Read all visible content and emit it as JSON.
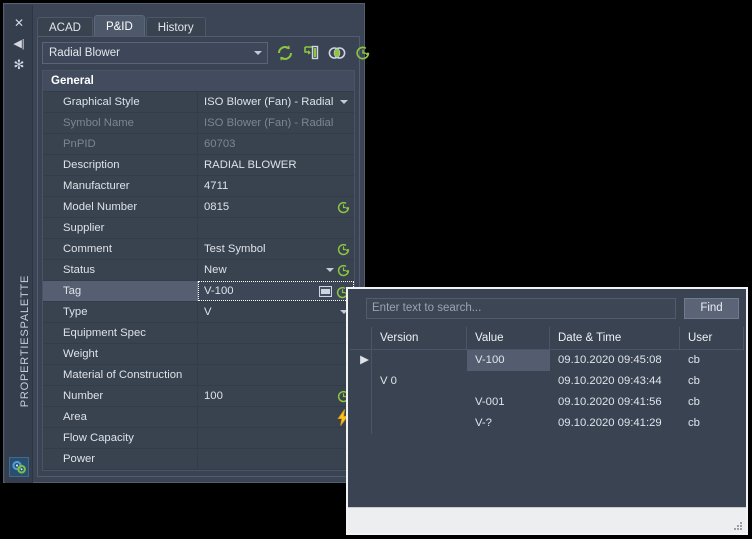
{
  "palette": {
    "vertical_title": "PROPERTIESPALETTE",
    "close_icon": "✕",
    "autohide_icon": "◀|",
    "menu_icon": "✻",
    "badge_icon": "properties-gears-icon"
  },
  "tabs": [
    {
      "label": "ACAD",
      "active": false
    },
    {
      "label": "P&ID",
      "active": true
    },
    {
      "label": "History",
      "active": false
    }
  ],
  "object_selector": {
    "value": "Radial Blower",
    "caret": "▾"
  },
  "toolbar": [
    {
      "name": "refresh-icon",
      "color": "#8cc63f"
    },
    {
      "name": "export-data-icon",
      "color": "#8cc63f"
    },
    {
      "name": "intersection-icon",
      "color": "#c9d2de"
    },
    {
      "name": "history-clock-icon",
      "color": "#8cc63f"
    }
  ],
  "group_header": "General",
  "properties": [
    {
      "label": "Graphical Style",
      "value": "ISO Blower (Fan) - Radial",
      "dim": false,
      "dropdown": true,
      "clock": false,
      "selected": false
    },
    {
      "label": "Symbol Name",
      "value": "ISO Blower (Fan) - Radial",
      "dim": true,
      "dropdown": false,
      "clock": false,
      "selected": false
    },
    {
      "label": "PnPID",
      "value": "60703",
      "dim": true,
      "dropdown": false,
      "clock": false,
      "selected": false
    },
    {
      "label": "Description",
      "value": "RADIAL BLOWER",
      "dim": false,
      "dropdown": false,
      "clock": false,
      "selected": false
    },
    {
      "label": "Manufacturer",
      "value": "4711",
      "dim": false,
      "dropdown": false,
      "clock": false,
      "selected": false
    },
    {
      "label": "Model Number",
      "value": "0815",
      "dim": false,
      "dropdown": false,
      "clock": true,
      "selected": false
    },
    {
      "label": "Supplier",
      "value": "",
      "dim": false,
      "dropdown": false,
      "clock": false,
      "selected": false
    },
    {
      "label": "Comment",
      "value": "Test Symbol",
      "dim": false,
      "dropdown": false,
      "clock": true,
      "selected": false
    },
    {
      "label": "Status",
      "value": "New",
      "dim": false,
      "dropdown": true,
      "clock": true,
      "selected": false
    },
    {
      "label": "Tag",
      "value": "V-100",
      "dim": false,
      "dropdown": false,
      "clock": true,
      "selected": true,
      "editing": true
    },
    {
      "label": "Type",
      "value": "V",
      "dim": false,
      "dropdown": true,
      "clock": false,
      "selected": false
    },
    {
      "label": "Equipment Spec",
      "value": "",
      "dim": false,
      "dropdown": false,
      "clock": false,
      "selected": false
    },
    {
      "label": "Weight",
      "value": "",
      "dim": false,
      "dropdown": false,
      "clock": false,
      "selected": false
    },
    {
      "label": "Material of Construction",
      "value": "",
      "dim": false,
      "dropdown": false,
      "clock": false,
      "selected": false
    },
    {
      "label": "Number",
      "value": "100",
      "dim": false,
      "dropdown": false,
      "clock": true,
      "selected": false
    },
    {
      "label": "Area",
      "value": "",
      "dim": false,
      "dropdown": false,
      "clock": false,
      "bolt": true,
      "selected": false
    },
    {
      "label": "Flow Capacity",
      "value": "",
      "dim": false,
      "dropdown": false,
      "clock": false,
      "selected": false
    },
    {
      "label": "Power",
      "value": "",
      "dim": false,
      "dropdown": false,
      "clock": false,
      "selected": false
    }
  ],
  "dialog": {
    "search_placeholder": "Enter text to search...",
    "search_value": "",
    "find_label": "Find",
    "columns": [
      "Version",
      "Value",
      "Date & Time",
      "User"
    ],
    "rows": [
      {
        "indicator": "▶",
        "version": "",
        "value": "V-100",
        "datetime": "09.10.2020 09:45:08",
        "user": "cb",
        "selected": true
      },
      {
        "indicator": "",
        "version": "V 0",
        "value": "",
        "datetime": "09.10.2020 09:43:44",
        "user": "cb",
        "selected": false
      },
      {
        "indicator": "",
        "version": "",
        "value": "V-001",
        "datetime": "09.10.2020 09:41:56",
        "user": "cb",
        "selected": false
      },
      {
        "indicator": "",
        "version": "",
        "value": "V-?",
        "datetime": "09.10.2020 09:41:29",
        "user": "cb",
        "selected": false
      }
    ]
  },
  "colors": {
    "accent_green": "#8cc63f",
    "bolt_yellow": "#f5c518",
    "panel_bg": "#3a4354",
    "selection": "#565f72"
  }
}
